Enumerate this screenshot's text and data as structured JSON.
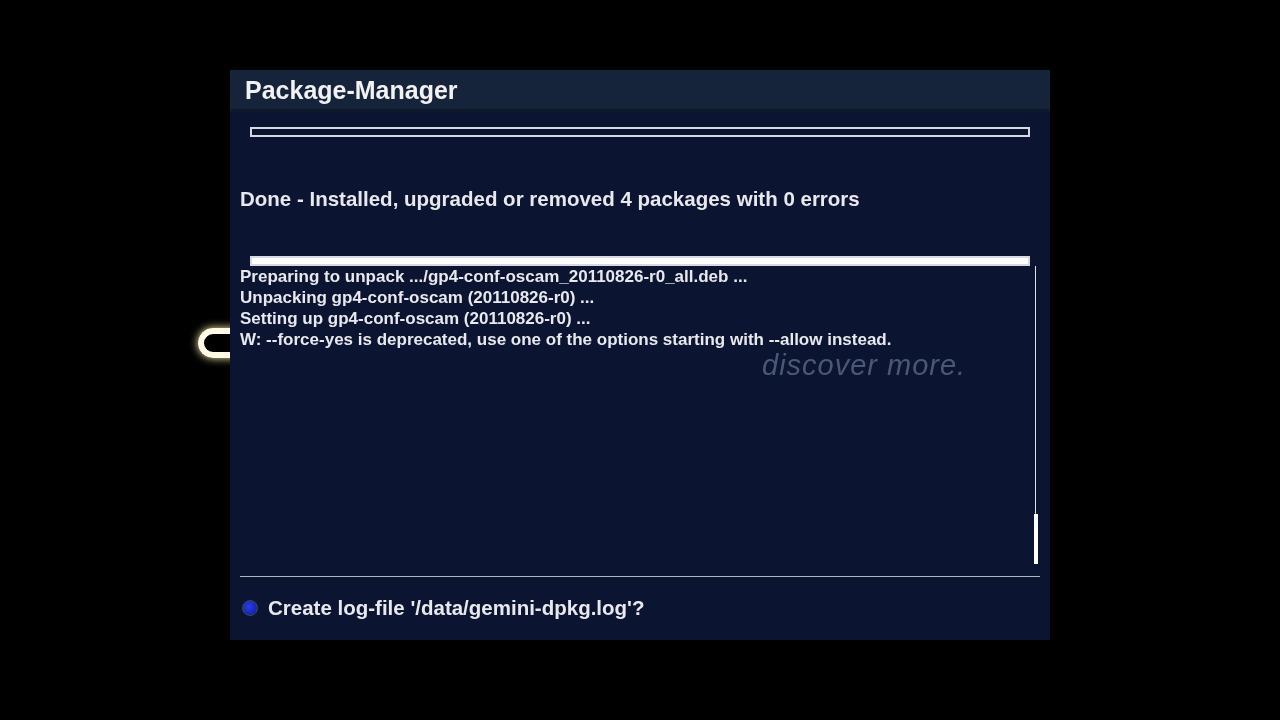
{
  "window": {
    "title": "Package-Manager"
  },
  "progress_top": {
    "level": 0
  },
  "status": "Done - Installed, upgraded or removed 4 packages with 0 errors",
  "progress_bottom": {
    "level": 1
  },
  "log": [
    "Preparing to unpack .../gp4-conf-oscam_20110826-r0_all.deb ...",
    "Unpacking gp4-conf-oscam (20110826-r0) ...",
    "Setting up gp4-conf-oscam (20110826-r0) ...",
    "W: --force-yes is deprecated, use one of the options starting with --allow instead."
  ],
  "background_tagline": "discover more.",
  "options": [
    {
      "label": "Create log-file '/data/gemini-dpkg.log'?",
      "selected": true
    }
  ]
}
